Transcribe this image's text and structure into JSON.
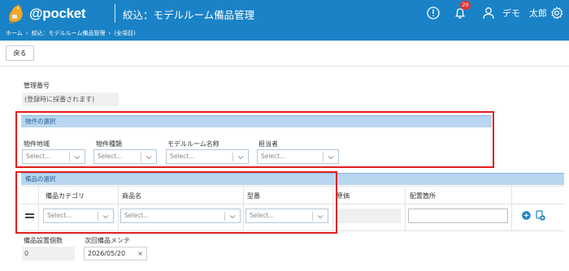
{
  "app": {
    "brand": "@pocket",
    "page_title": "絞込：モデルルーム備品管理",
    "notification_count": "20",
    "user_name": "デモ　太郎"
  },
  "breadcrumb": {
    "items": [
      "ホーム",
      "絞込：モデルルーム備品管理",
      "(全項目)"
    ],
    "separator": "›"
  },
  "toolbar": {
    "back_label": "戻る"
  },
  "management": {
    "label": "管理番号",
    "value": "(登録時に採番されます)"
  },
  "property_section": {
    "title": "物件の選択",
    "fields": [
      {
        "label": "物件地域",
        "placeholder": "Select..."
      },
      {
        "label": "物件種類",
        "placeholder": "Select..."
      },
      {
        "label": "モデルルーム名称",
        "placeholder": "Select..."
      },
      {
        "label": "担当者",
        "placeholder": "Select..."
      }
    ]
  },
  "equipment_section": {
    "title": "備品の選択",
    "columns": [
      "備品カテゴリ",
      "商品名",
      "型番",
      "原価",
      "配置箇所"
    ],
    "row": {
      "category_placeholder": "Select...",
      "product_placeholder": "Select...",
      "model_placeholder": "Select...",
      "cost": "",
      "location": ""
    }
  },
  "footer_fields": {
    "count_label": "備品設置個数",
    "count_value": "0",
    "maintenance_label": "次回備品メンテ",
    "maintenance_value": "2026/05/20",
    "clear_glyph": "×"
  },
  "colors": {
    "header": "#1a82c6",
    "section_bar": "#b8d6ef",
    "highlight": "#e31d1d",
    "add_button": "#1a82c6"
  }
}
